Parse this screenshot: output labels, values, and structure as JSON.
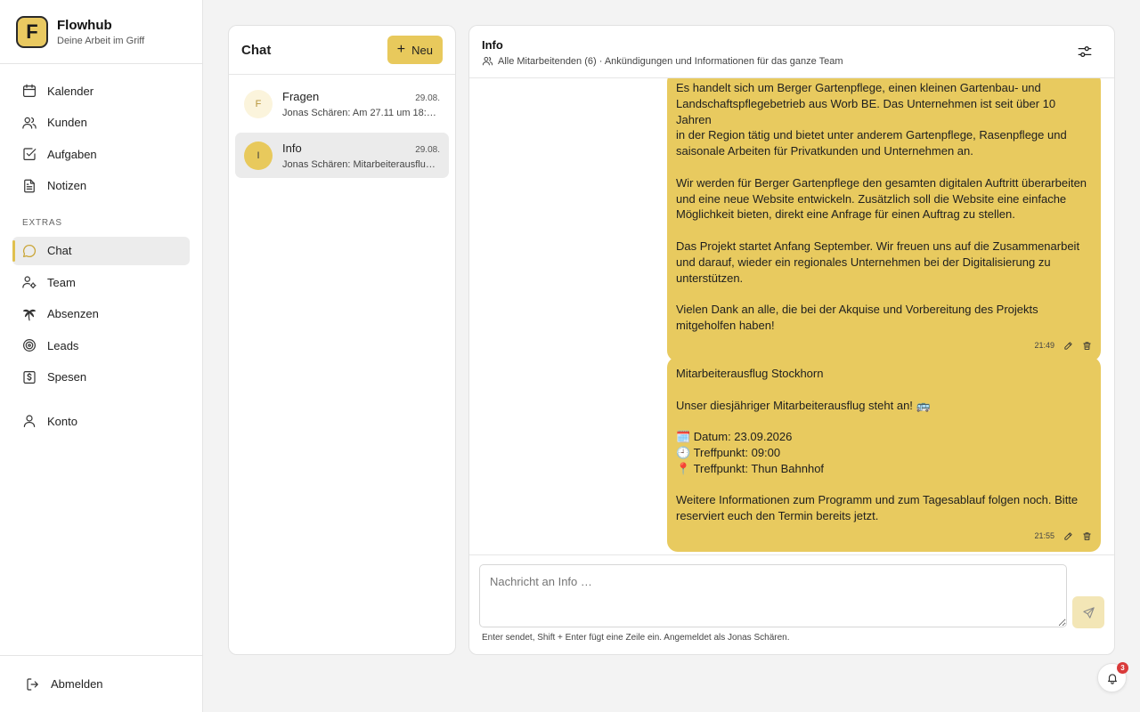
{
  "brand": {
    "logo_letter": "F",
    "name": "Flowhub",
    "tagline": "Deine Arbeit im Griff"
  },
  "nav": {
    "items": [
      {
        "label": "Kalender",
        "icon": "calendar-icon"
      },
      {
        "label": "Kunden",
        "icon": "users-icon"
      },
      {
        "label": "Aufgaben",
        "icon": "checkbox-icon"
      },
      {
        "label": "Notizen",
        "icon": "notes-icon"
      }
    ],
    "extras_heading": "EXTRAS",
    "extras": [
      {
        "label": "Chat",
        "icon": "chat-icon",
        "active": true
      },
      {
        "label": "Team",
        "icon": "team-icon"
      },
      {
        "label": "Absenzen",
        "icon": "palm-tree-icon"
      },
      {
        "label": "Leads",
        "icon": "target-icon"
      },
      {
        "label": "Spesen",
        "icon": "receipt-icon"
      }
    ],
    "account": {
      "label": "Konto",
      "icon": "user-icon"
    },
    "logout": {
      "label": "Abmelden",
      "icon": "logout-icon"
    }
  },
  "chatlist": {
    "title": "Chat",
    "new_button": "Neu",
    "conversations": [
      {
        "initial": "F",
        "name": "Fragen",
        "date": "29.08.",
        "preview": "Jonas Schären: Am 27.11 um 18:00 …"
      },
      {
        "initial": "I",
        "name": "Info",
        "date": "29.08.",
        "preview": "Jonas Schären: Mitarbeiterausflug…",
        "active": true
      }
    ]
  },
  "conversation": {
    "title": "Info",
    "subtitle": "Alle Mitarbeitenden (6) · Ankündigungen und Informationen für das ganze Team",
    "messages": [
      {
        "paragraphs": [
          [
            "Es handelt sich um  Berger Gartenpflege, einen kleinen Gartenbau- und",
            "Landschaftspflegebetrieb aus Worb BE. Das Unternehmen ist seit über 10 Jahren",
            "in der Region tätig und bietet unter anderem Gartenpflege, Rasenpflege und",
            "saisonale Arbeiten für Privatkunden und Unternehmen an."
          ],
          [
            "Wir werden für Berger Gartenpflege den gesamten digitalen Auftritt überarbeiten",
            "und eine neue Website entwickeln. Zusätzlich soll die Website eine einfache",
            "Möglichkeit bieten, direkt eine Anfrage für einen Auftrag zu stellen."
          ],
          [
            "Das Projekt startet Anfang September. Wir freuen uns auf die Zusammenarbeit",
            "und darauf, wieder ein regionales Unternehmen bei der Digitalisierung zu",
            "unterstützen."
          ],
          [
            "Vielen Dank an alle, die bei der Akquise und Vorbereitung des Projekts",
            "mitgeholfen haben!"
          ]
        ],
        "time": "21:49"
      },
      {
        "paragraphs": [
          [
            "Mitarbeiterausflug Stockhorn"
          ],
          [
            "Unser diesjähriger Mitarbeiterausflug steht an! 🚌"
          ],
          [
            "🗓️ Datum: 23.09.2026",
            "🕘 Treffpunkt: 09:00",
            "📍 Treffpunkt: Thun Bahnhof"
          ],
          [
            "Weitere Informationen zum Programm und zum Tagesablauf folgen noch. Bitte",
            "reserviert euch den Termin bereits jetzt."
          ]
        ],
        "time": "21:55"
      }
    ]
  },
  "composer": {
    "placeholder": "Nachricht an Info …",
    "hint": "Enter sendet, Shift + Enter fügt eine Zeile ein. Angemeldet als Jonas Schären."
  },
  "notifications": {
    "count": "3"
  },
  "colors": {
    "accent": "#e8c95c",
    "badge": "#d93a3a"
  }
}
